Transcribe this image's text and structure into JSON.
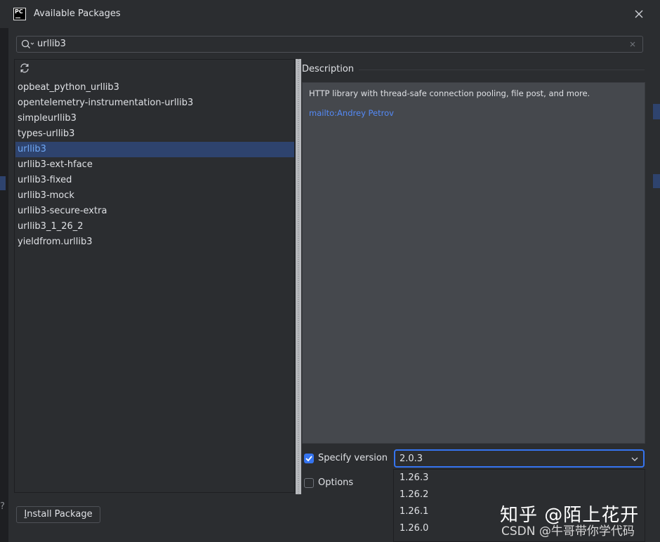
{
  "window": {
    "title": "Available Packages",
    "logo_text": "PC"
  },
  "search": {
    "value": "urllib3"
  },
  "packages": [
    "opbeat_python_urllib3",
    "opentelemetry-instrumentation-urllib3",
    "simpleurllib3",
    "types-urllib3",
    "urllib3",
    "urllib3-ext-hface",
    "urllib3-fixed",
    "urllib3-mock",
    "urllib3-secure-extra",
    "urllib3_1_26_2",
    "yieldfrom.urllib3"
  ],
  "selected_package": "urllib3",
  "description": {
    "label": "Description",
    "text": "HTTP library with thread-safe connection pooling, file post, and more.",
    "link": "mailto:Andrey Petrov"
  },
  "specify_version": {
    "label": "Specify version",
    "checked": true,
    "value": "2.0.3"
  },
  "version_options": [
    "1.26.3",
    "1.26.2",
    "1.26.1",
    "1.26.0"
  ],
  "options": {
    "label": "Options",
    "checked": false
  },
  "install_button": {
    "label_underlined": "I",
    "label_rest": "nstall Package"
  },
  "watermark": {
    "line1": "知乎 @陌上花开",
    "line2": "CSDN @牛哥带你学代码"
  },
  "colors": {
    "accent": "#3574f0",
    "selection": "#2e436e",
    "link": "#548af7"
  }
}
